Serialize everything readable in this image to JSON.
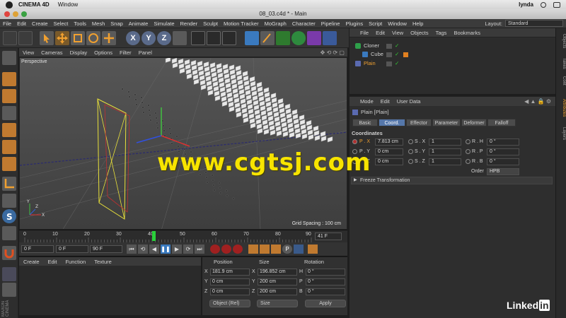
{
  "mac": {
    "app": "CINEMA 4D",
    "window_menu": "Window",
    "user": "lynda"
  },
  "window": {
    "title": "08_03.c4d * - Main"
  },
  "menu": [
    "File",
    "Edit",
    "Create",
    "Select",
    "Tools",
    "Mesh",
    "Snap",
    "Animate",
    "Simulate",
    "Render",
    "Sculpt",
    "Motion Tracker",
    "MoGraph",
    "Character",
    "Pipeline",
    "Plugins",
    "Script",
    "Window",
    "Help"
  ],
  "layout": {
    "label": "Layout:",
    "value": "Standard"
  },
  "viewport": {
    "menu": [
      "View",
      "Cameras",
      "Display",
      "Options",
      "Filter",
      "Panel"
    ],
    "label": "Perspective",
    "grid_spacing": "Grid Spacing : 100 cm"
  },
  "timeline": {
    "ticks": [
      "0",
      "10",
      "20",
      "30",
      "40",
      "50",
      "60",
      "70",
      "80",
      "90"
    ],
    "current_frame": "41 F",
    "start": "0 F",
    "preview_start": "0 F",
    "end": "90 F"
  },
  "materials": {
    "menu": [
      "Create",
      "Edit",
      "Function",
      "Texture"
    ]
  },
  "coord": {
    "headers": [
      "Position",
      "Size",
      "Rotation"
    ],
    "rows": [
      {
        "axis": "X",
        "pos": "181.9 cm",
        "size_axis": "X",
        "size": "196.852 cm",
        "rot_axis": "H",
        "rot": "0 °"
      },
      {
        "axis": "Y",
        "pos": "0 cm",
        "size_axis": "Y",
        "size": "200 cm",
        "rot_axis": "P",
        "rot": "0 °"
      },
      {
        "axis": "Z",
        "pos": "0 cm",
        "size_axis": "Z",
        "size": "200 cm",
        "rot_axis": "B",
        "rot": "0 °"
      }
    ],
    "mode": "Object (Rel)",
    "size_mode": "Size",
    "apply": "Apply"
  },
  "objects": {
    "menu": [
      "File",
      "Edit",
      "View",
      "Objects",
      "Tags",
      "Bookmarks"
    ],
    "items": [
      {
        "name": "Cloner"
      },
      {
        "name": "Cube"
      },
      {
        "name": "Plain"
      }
    ]
  },
  "attributes": {
    "menu": [
      "Mode",
      "Edit",
      "User Data"
    ],
    "object_title": "Plain [Plain]",
    "tabs": [
      "Basic",
      "Coord.",
      "Effector",
      "Parameter",
      "Deformer",
      "Falloff"
    ],
    "active_tab": "Coord.",
    "section": "Coordinates",
    "fields": [
      {
        "p": "P . X",
        "pv": "7.813 cm",
        "s": "S . X",
        "sv": "1",
        "r": "R . H",
        "rv": "0 °"
      },
      {
        "p": "P . Y",
        "pv": "0 cm",
        "s": "S . Y",
        "sv": "1",
        "r": "R . P",
        "rv": "0 °"
      },
      {
        "p": "P . Z",
        "pv": "0 cm",
        "s": "S . Z",
        "sv": "1",
        "r": "R . B",
        "rv": "0 °"
      }
    ],
    "order_label": "Order",
    "order_value": "HPB",
    "freeze": "Freeze Transformation"
  },
  "right_tabs": [
    "Objects",
    "Takes",
    "Cont",
    "Attributes",
    "Layers"
  ],
  "branding": {
    "watermark": "www.cgtsj.com",
    "linkedin": "Linked",
    "linkedin_in": "in",
    "maxon": "MAXON",
    "cinema": "CINEMA"
  },
  "colors": {
    "accent_orange": "#f0a030",
    "watermark_yellow": "#f7e400",
    "active_tab": "#5577aa"
  }
}
